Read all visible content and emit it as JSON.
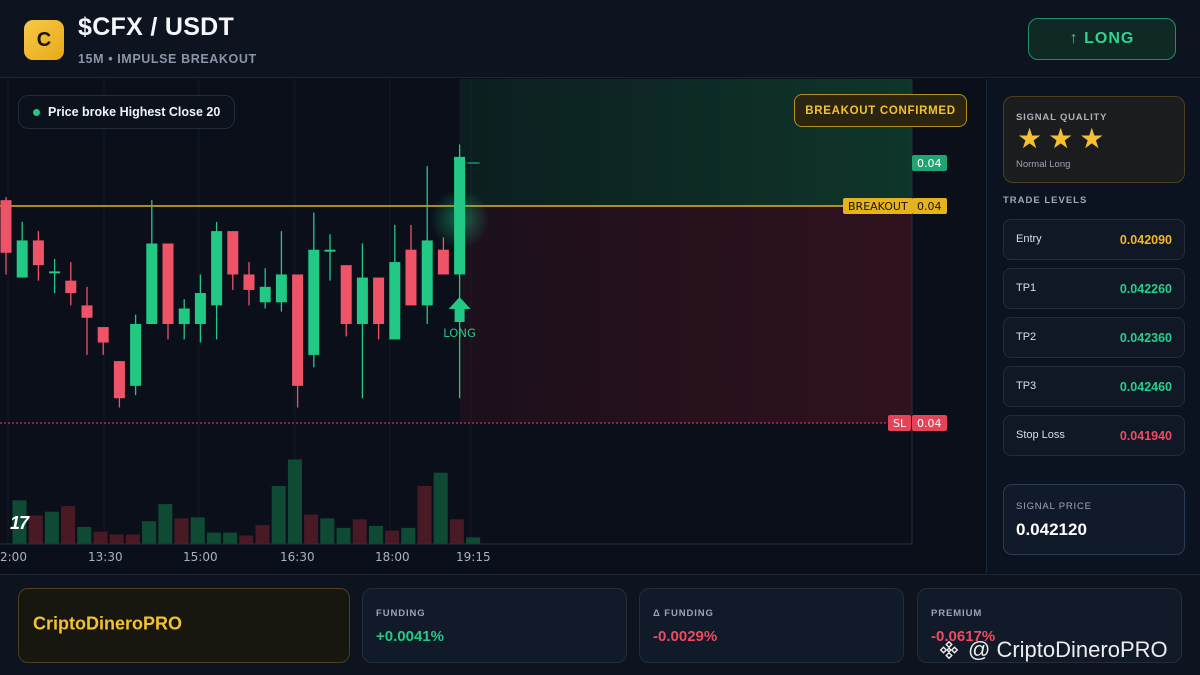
{
  "header": {
    "logo_letter": "C",
    "pair": "$CFX / USDT",
    "subtitle": "15M • IMPULSE BREAKOUT",
    "direction_button": "↑ LONG"
  },
  "chart": {
    "info_pill": "Price broke Highest Close 20",
    "confirm_badge": "BREAKOUT CONFIRMED",
    "tv_logo": "17",
    "signal_marker_label": "LONG",
    "breakout_label": "BREAKOUT",
    "sl_label": "SL",
    "price_tags": {
      "top": "0.04",
      "breakout": "0.04",
      "sl": "0.04"
    },
    "time_labels": [
      "2:00",
      "13:30",
      "15:00",
      "16:30",
      "18:00",
      "19:15"
    ],
    "colors": {
      "up": "#22c985",
      "down": "#ef5368",
      "breakout_line": "#e4b31e",
      "sl_line": "#e64358"
    }
  },
  "chart_data": {
    "type": "candlestick",
    "title": "$CFX / USDT",
    "timeframe": "15M",
    "x_ticks": [
      "2:00",
      "13:30",
      "15:00",
      "16:30",
      "18:00",
      "19:15"
    ],
    "levels": {
      "breakout": 0.04,
      "stop_loss": 0.04
    },
    "candles": [
      {
        "dir": "down",
        "o": 0.04222,
        "c": 0.04205,
        "h": 0.04223,
        "l": 0.04198
      },
      {
        "dir": "up",
        "o": 0.04197,
        "c": 0.04209,
        "h": 0.04215,
        "l": 0.04197
      },
      {
        "dir": "down",
        "o": 0.04209,
        "c": 0.04201,
        "h": 0.04212,
        "l": 0.04196
      },
      {
        "dir": "up",
        "o": 0.04199,
        "c": 0.04199,
        "h": 0.04203,
        "l": 0.04192
      },
      {
        "dir": "down",
        "o": 0.04196,
        "c": 0.04192,
        "h": 0.04202,
        "l": 0.04188
      },
      {
        "dir": "down",
        "o": 0.04188,
        "c": 0.04184,
        "h": 0.04194,
        "l": 0.04172
      },
      {
        "dir": "down",
        "o": 0.04181,
        "c": 0.04176,
        "h": 0.04181,
        "l": 0.04172
      },
      {
        "dir": "down",
        "o": 0.0417,
        "c": 0.04158,
        "h": 0.0417,
        "l": 0.04155
      },
      {
        "dir": "up",
        "o": 0.04162,
        "c": 0.04182,
        "h": 0.04185,
        "l": 0.04159
      },
      {
        "dir": "up",
        "o": 0.04182,
        "c": 0.04208,
        "h": 0.04222,
        "l": 0.04182
      },
      {
        "dir": "down",
        "o": 0.04208,
        "c": 0.04182,
        "h": 0.04208,
        "l": 0.04177
      },
      {
        "dir": "up",
        "o": 0.04182,
        "c": 0.04187,
        "h": 0.0419,
        "l": 0.04177
      },
      {
        "dir": "up",
        "o": 0.04182,
        "c": 0.04192,
        "h": 0.04198,
        "l": 0.04176
      },
      {
        "dir": "up",
        "o": 0.04188,
        "c": 0.04212,
        "h": 0.04215,
        "l": 0.04177
      },
      {
        "dir": "down",
        "o": 0.04212,
        "c": 0.04198,
        "h": 0.04212,
        "l": 0.04193
      },
      {
        "dir": "down",
        "o": 0.04198,
        "c": 0.04193,
        "h": 0.04202,
        "l": 0.04188
      },
      {
        "dir": "up",
        "o": 0.04189,
        "c": 0.04194,
        "h": 0.042,
        "l": 0.04187
      },
      {
        "dir": "up",
        "o": 0.04189,
        "c": 0.04198,
        "h": 0.04212,
        "l": 0.04186
      },
      {
        "dir": "down",
        "o": 0.04198,
        "c": 0.04162,
        "h": 0.04198,
        "l": 0.04155
      },
      {
        "dir": "up",
        "o": 0.04172,
        "c": 0.04206,
        "h": 0.04218,
        "l": 0.04168
      },
      {
        "dir": "up",
        "o": 0.04206,
        "c": 0.04206,
        "h": 0.04211,
        "l": 0.04196
      },
      {
        "dir": "down",
        "o": 0.04201,
        "c": 0.04182,
        "h": 0.04201,
        "l": 0.04178
      },
      {
        "dir": "up",
        "o": 0.04182,
        "c": 0.04197,
        "h": 0.04208,
        "l": 0.04158
      },
      {
        "dir": "down",
        "o": 0.04197,
        "c": 0.04182,
        "h": 0.04197,
        "l": 0.04177
      },
      {
        "dir": "up",
        "o": 0.04177,
        "c": 0.04202,
        "h": 0.04214,
        "l": 0.04177
      },
      {
        "dir": "down",
        "o": 0.04206,
        "c": 0.04188,
        "h": 0.04214,
        "l": 0.04188
      },
      {
        "dir": "up",
        "o": 0.04188,
        "c": 0.04209,
        "h": 0.04233,
        "l": 0.04182
      },
      {
        "dir": "down",
        "o": 0.04206,
        "c": 0.04198,
        "h": 0.0421,
        "l": 0.04198
      },
      {
        "dir": "up",
        "o": 0.04198,
        "c": 0.04236,
        "h": 0.0424,
        "l": 0.04158
      }
    ],
    "volume": [
      0.46,
      0.3,
      0.34,
      0.4,
      0.18,
      0.13,
      0.1,
      0.1,
      0.24,
      0.42,
      0.27,
      0.28,
      0.12,
      0.12,
      0.09,
      0.2,
      0.61,
      0.89,
      0.31,
      0.27,
      0.17,
      0.26,
      0.19,
      0.14,
      0.17,
      0.61,
      0.75,
      0.26,
      0.07
    ],
    "volume_dirs": [
      "up",
      "down",
      "up",
      "down",
      "up",
      "down",
      "down",
      "down",
      "up",
      "up",
      "down",
      "up",
      "up",
      "up",
      "down",
      "down",
      "up",
      "up",
      "down",
      "up",
      "up",
      "down",
      "up",
      "down",
      "up",
      "down",
      "up",
      "down",
      "up"
    ]
  },
  "signal_quality": {
    "title": "SIGNAL QUALITY",
    "rating": 3,
    "max_rating": 3,
    "label": "Normal Long"
  },
  "trade_levels": {
    "title": "TRADE LEVELS",
    "items": [
      {
        "label": "Entry",
        "value": "0.042090",
        "color": "#f3b725"
      },
      {
        "label": "TP1",
        "value": "0.042260",
        "color": "#25d08c"
      },
      {
        "label": "TP2",
        "value": "0.042360",
        "color": "#25d08c"
      },
      {
        "label": "TP3",
        "value": "0.042460",
        "color": "#25d08c"
      },
      {
        "label": "Stop Loss",
        "value": "0.041940",
        "color": "#ef4a60"
      }
    ]
  },
  "signal_price": {
    "title": "SIGNAL PRICE",
    "value": "0.042120"
  },
  "footer": {
    "brand": "CriptoDineroPRO",
    "stats": [
      {
        "title": "FUNDING",
        "value": "+0.0041%",
        "color": "#22c985"
      },
      {
        "title": "Δ FUNDING",
        "value": "-0.0029%",
        "color": "#ef4a60"
      },
      {
        "title": "PREMIUM",
        "value": "-0.0617%",
        "color": "#ef4a60"
      }
    ],
    "watermark": "@ CriptoDineroPRO"
  }
}
